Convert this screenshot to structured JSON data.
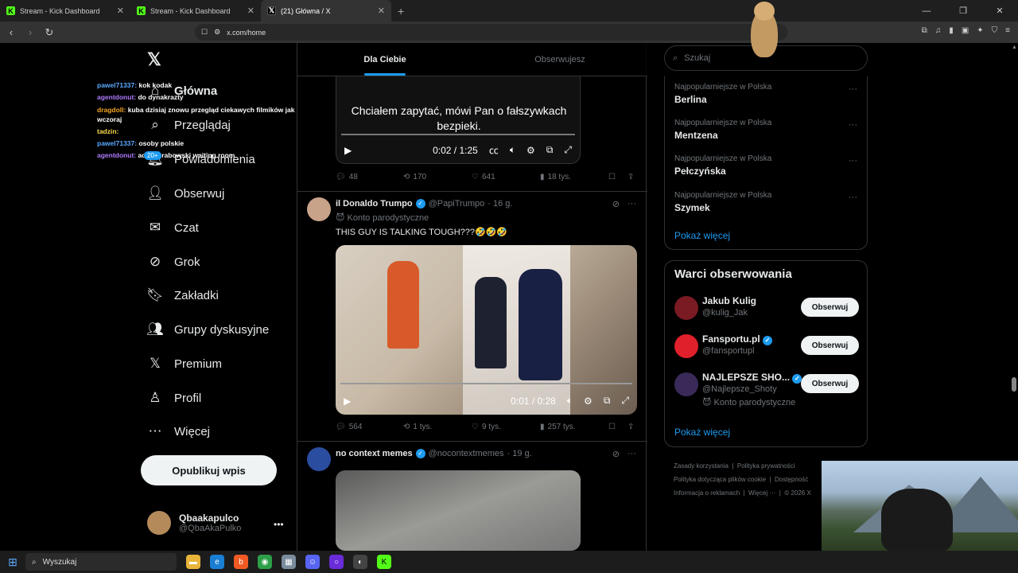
{
  "browser": {
    "tabs": [
      {
        "title": "Stream - Kick Dashboard",
        "favicon": "K"
      },
      {
        "title": "Stream - Kick Dashboard",
        "favicon": "K"
      },
      {
        "title": "(21) Główna / X",
        "favicon": "X"
      }
    ],
    "url": "x.com/home"
  },
  "nav": {
    "items": [
      {
        "label": "Główna",
        "icon": "home-icon"
      },
      {
        "label": "Przeglądaj",
        "icon": "search-icon"
      },
      {
        "label": "Powiadomienia",
        "icon": "bell-icon"
      },
      {
        "label": "Obserwuj",
        "icon": "add-person-icon"
      },
      {
        "label": "Czat",
        "icon": "mail-icon"
      },
      {
        "label": "Grok",
        "icon": "grok-icon"
      },
      {
        "label": "Zakładki",
        "icon": "bookmark-icon"
      },
      {
        "label": "Grupy dyskusyjne",
        "icon": "groups-icon"
      },
      {
        "label": "Premium",
        "icon": "x-icon"
      },
      {
        "label": "Profil",
        "icon": "person-icon"
      },
      {
        "label": "Więcej",
        "icon": "more-circle-icon"
      }
    ],
    "notif_badge": "20+",
    "post_button": "Opublikuj wpis",
    "profile": {
      "name": "Qbaakapulco",
      "handle": "@QbaAkaPulko"
    }
  },
  "chat": [
    {
      "user": "pawel71337:",
      "msg": "kok kodak"
    },
    {
      "user": "agentdonut:",
      "msg": "do dynakrazty"
    },
    {
      "user": "dragdoll:",
      "msg": "kuba dzisiaj znowu przegląd ciekawych filmików jak wczoraj"
    },
    {
      "user": "tadzin:",
      "msg": ""
    },
    {
      "user": "pawel71337:",
      "msg": "osoby polskie"
    },
    {
      "user": "agentdonut:",
      "msg": "adam grabowski waiting room"
    }
  ],
  "feed": {
    "tabs": [
      "Dla Ciebie",
      "Obserwujesz"
    ],
    "post1": {
      "subtitle": "Chciałem zapytać, mówi Pan o fałszywkach bezpieki.",
      "time": "0:02 / 1:25",
      "replies": "48",
      "reposts": "170",
      "likes": "641",
      "views": "18 tys."
    },
    "post2": {
      "name": "il Donaldo Trumpo",
      "handle": "@PapiTrumpo",
      "age": "· 16 g.",
      "label": "Konto parodystyczne",
      "text": "THIS GUY IS TALKING TOUGH???🤣🤣🤣",
      "time": "0:01 / 0:28",
      "replies": "564",
      "reposts": "1 tys.",
      "likes": "9 tys.",
      "views": "257 tys."
    },
    "post3": {
      "name": "no context memes",
      "handle": "@nocontextmemes",
      "age": "· 19 g."
    }
  },
  "right": {
    "search_placeholder": "Szukaj",
    "trends": [
      {
        "context": "Najpopularniejsze w Polska",
        "name": "Berlina"
      },
      {
        "context": "Najpopularniejsze w Polska",
        "name": "Mentzena"
      },
      {
        "context": "Najpopularniejsze w Polska",
        "name": "Pełczyńska"
      },
      {
        "context": "Najpopularniejsze w Polska",
        "name": "Szymek"
      }
    ],
    "show_more": "Pokaż więcej",
    "who_title": "Warci obserwowania",
    "who": [
      {
        "name": "Jakub Kulig",
        "handle": "@kulig_Jak",
        "sub": "",
        "verified": false
      },
      {
        "name": "Fansportu.pl",
        "handle": "@fansportupl",
        "sub": "",
        "verified": true
      },
      {
        "name": "NAJLEPSZE SHO...",
        "handle": "@Najlepsze_Shoty",
        "sub": "Konto parodystyczne",
        "verified": true
      }
    ],
    "follow_label": "Obserwuj",
    "footer": {
      "l1a": "Zasady korzystania",
      "l1b": "Polityka prywatności",
      "l2a": "Polityka dotycząca plików cookie",
      "l2b": "Dostępność",
      "l3a": "Informacja o reklamach",
      "l3b": "Więcej ···",
      "l3c": "© 2026 X"
    }
  },
  "taskbar": {
    "search": "Wyszukaj"
  },
  "colors": {
    "accent": "#1d9bf0",
    "background": "#000000",
    "kick": "#53fc18"
  }
}
